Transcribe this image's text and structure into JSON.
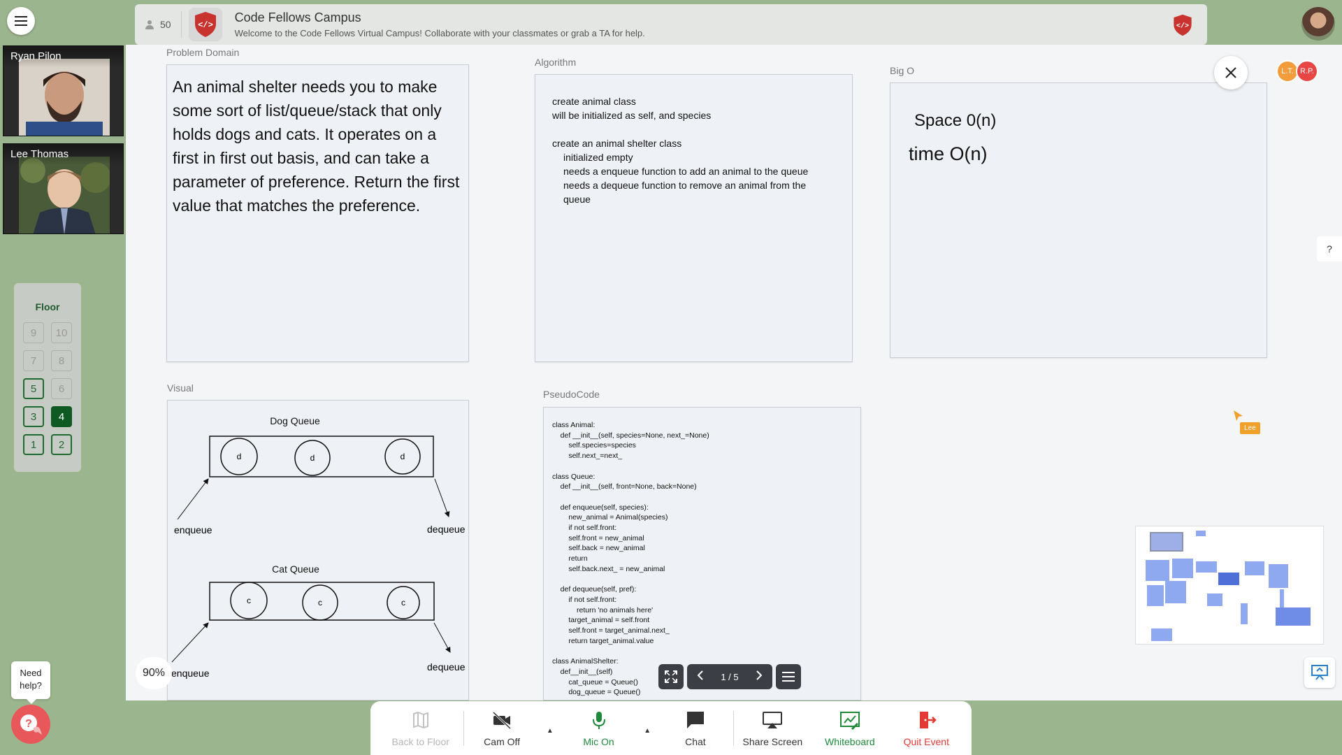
{
  "header": {
    "participant_count": "50",
    "title": "Code Fellows Campus",
    "subtitle": "Welcome to the Code Fellows Virtual Campus! Collaborate with your classmates or grab a TA for help."
  },
  "videos": [
    {
      "name": "Ryan Pilon"
    },
    {
      "name": "Lee Thomas"
    }
  ],
  "floor": {
    "label": "Floor",
    "buttons": [
      {
        "label": "9",
        "state": "disabled"
      },
      {
        "label": "10",
        "state": "disabled"
      },
      {
        "label": "7",
        "state": "disabled"
      },
      {
        "label": "8",
        "state": "disabled"
      },
      {
        "label": "5",
        "state": "enabled"
      },
      {
        "label": "6",
        "state": "disabled"
      },
      {
        "label": "3",
        "state": "enabled"
      },
      {
        "label": "4",
        "state": "selected"
      },
      {
        "label": "1",
        "state": "enabled"
      },
      {
        "label": "2",
        "state": "enabled"
      }
    ]
  },
  "presence": [
    {
      "initials": "L.T.",
      "color": "#f39c3b"
    },
    {
      "initials": "R.P.",
      "color": "#e84545"
    }
  ],
  "problem": {
    "label": "Problem Domain",
    "text": "An animal shelter needs you to make some sort of list/queue/stack that only holds dogs and cats. It operates on a first in first out basis, and can take a parameter of preference. Return the first value that matches the preference."
  },
  "algorithm": {
    "label": "Algorithm",
    "lines": [
      {
        "text": "create animal class",
        "indent": 0
      },
      {
        "text": "will be initialized as self, and species",
        "indent": 0
      },
      {
        "text": "",
        "indent": 0
      },
      {
        "text": "create an animal shelter class",
        "indent": 0
      },
      {
        "text": "initialized empty",
        "indent": 1
      },
      {
        "text": "needs a enqueue function to add an animal to the queue",
        "indent": 1
      },
      {
        "text": "needs a dequeue function to remove an animal from the queue",
        "indent": 1
      }
    ]
  },
  "bigo": {
    "label": "Big O",
    "space": "Space 0(n)",
    "time": "time O(n)"
  },
  "visual": {
    "label": "Visual",
    "dog_title": "Dog Queue",
    "cat_title": "Cat Queue",
    "dog_node": "d",
    "cat_node": "c",
    "enqueue": "enqueue",
    "dequeue": "dequeue"
  },
  "pseudocode": {
    "label": "PseudoCode",
    "code": "class Animal:\n    def __init__(self, species=None, next_=None)\n        self.species=species\n        self.next_=next_\n\nclass Queue:\n    def __init__(self, front=None, back=None)\n\n    def enqueue(self, species):\n        new_animal = Animal(species)\n        if not self.front:\n        self.front = new_animal\n        self.back = new_animal\n        return\n        self.back.next_ = new_animal\n\n    def dequeue(self, pref):\n        if not self.front:\n            return 'no animals here'\n        target_animal = self.front\n        self.front = target_animal.next_\n        return target_animal.value\n\nclass AnimalShelter:\n    def__init__(self)\n        cat_queue = Queue()\n        dog_queue = Queue()"
  },
  "help_tab": "?",
  "cursor_label": "Lee",
  "zoom": "90%",
  "pager": {
    "text": "1 / 5"
  },
  "need_help": "Need help?",
  "toolbar": {
    "back_to_floor": "Back to Floor",
    "cam": "Cam Off",
    "mic": "Mic On",
    "chat": "Chat",
    "share": "Share Screen",
    "whiteboard": "Whiteboard",
    "quit": "Quit Event"
  },
  "colors": {
    "accent_green": "#1f8a3a",
    "quit_red": "#e53935",
    "disabled": "#b0b0b0",
    "brand_red": "#c8332f"
  }
}
